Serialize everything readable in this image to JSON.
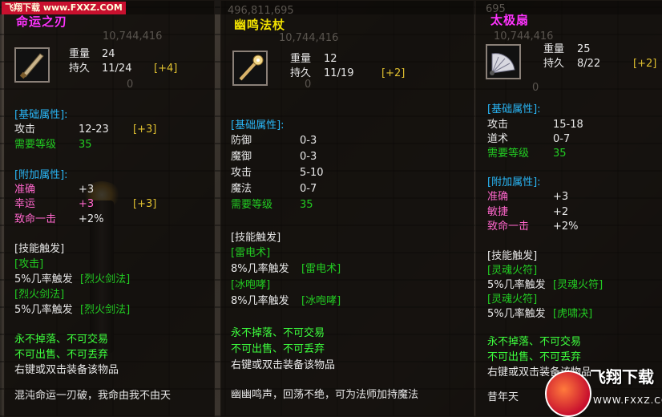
{
  "watermark_top": {
    "name": "飞翔下载",
    "url": "www.FXXZ.COM"
  },
  "watermark_bottom": {
    "name": "飞翔下载",
    "url": "WWW.FXXZ.COM"
  },
  "panels": [
    {
      "bg_numbers": [
        "10,744,416",
        "0"
      ],
      "title": "命运之刃",
      "weight_label": "重量",
      "weight": "24",
      "durability_label": "持久",
      "durability": "11/24",
      "durability_bonus": "[+4]",
      "base_header": "[基础属性]:",
      "base_stats": [
        {
          "label": "攻击",
          "value": "12-23",
          "bonus": "[+3]"
        },
        {
          "label": "需要等级",
          "value": "35",
          "bonus": ""
        }
      ],
      "extra_header": "[附加属性]:",
      "extra_stats": [
        {
          "label": "准确",
          "value": "+3",
          "bonus": ""
        },
        {
          "label": "幸运",
          "value": "+3",
          "bonus": "[+3]"
        },
        {
          "label": "致命一击",
          "value": "+2%",
          "bonus": ""
        }
      ],
      "skill_header": "[技能触发]",
      "skills": [
        {
          "name": "[攻击]",
          "trigger": "5%几率触发",
          "effect": "[烈火剑法]"
        },
        {
          "name": "[烈火剑法]",
          "trigger": "5%几率触发",
          "effect": "[烈火剑法]"
        }
      ],
      "notes": [
        "永不掉落、不可交易",
        "不可出售、不可丢弃",
        "右键或双击装备该物品"
      ],
      "flavor": "混沌命运一刃破，我命由我不由天"
    },
    {
      "bg_numbers": [
        "496,811,695",
        "10,744,416",
        "0"
      ],
      "title": "幽鸣法杖",
      "weight_label": "重量",
      "weight": "12",
      "durability_label": "持久",
      "durability": "11/19",
      "durability_bonus": "[+2]",
      "base_header": "[基础属性]:",
      "base_stats": [
        {
          "label": "防御",
          "value": "0-3",
          "bonus": ""
        },
        {
          "label": "魔御",
          "value": "0-3",
          "bonus": ""
        },
        {
          "label": "攻击",
          "value": "5-10",
          "bonus": ""
        },
        {
          "label": "魔法",
          "value": "0-7",
          "bonus": ""
        },
        {
          "label": "需要等级",
          "value": "35",
          "bonus": ""
        }
      ],
      "skill_header": "[技能触发]",
      "skills": [
        {
          "name": "[雷电术]",
          "trigger": "8%几率触发",
          "effect": "[雷电术]"
        },
        {
          "name": "[冰咆哮]",
          "trigger": "8%几率触发",
          "effect": "[冰咆哮]"
        }
      ],
      "notes": [
        "永不掉落、不可交易",
        "不可出售、不可丢弃",
        "右键或双击装备该物品"
      ],
      "flavor": "幽幽鸣声，回荡不绝，可为法师加持魔法"
    },
    {
      "bg_numbers": [
        "695",
        "10,744,416",
        "0"
      ],
      "title": "太极扇",
      "weight_label": "重量",
      "weight": "25",
      "durability_label": "持久",
      "durability": "8/22",
      "durability_bonus": "[+2]",
      "base_header": "[基础属性]:",
      "base_stats": [
        {
          "label": "攻击",
          "value": "15-18",
          "bonus": ""
        },
        {
          "label": "道术",
          "value": "0-7",
          "bonus": ""
        },
        {
          "label": "需要等级",
          "value": "35",
          "bonus": ""
        }
      ],
      "extra_header": "[附加属性]:",
      "extra_stats": [
        {
          "label": "准确",
          "value": "+3",
          "bonus": ""
        },
        {
          "label": "敏捷",
          "value": "+2",
          "bonus": ""
        },
        {
          "label": "致命一击",
          "value": "+2%",
          "bonus": ""
        }
      ],
      "skill_header": "[技能触发]",
      "skills": [
        {
          "name": "[灵魂火符]",
          "trigger": "5%几率触发",
          "effect": "[灵魂火符]"
        },
        {
          "name": "[灵魂火符]",
          "trigger": "5%几率触发",
          "effect": "[虎啸决]"
        }
      ],
      "notes": [
        "永不掉落、不可交易",
        "不可出售、不可丢弃",
        "右键或双击装备该物品"
      ],
      "flavor": "昔年天"
    }
  ],
  "colors": {
    "title_magenta": "#ff33ff",
    "title_yellow": "#f0e000",
    "header_cyan": "#29b6f6",
    "text_green": "#22cc22",
    "text_white": "#e8e8e8",
    "luck_pink": "#ff66cc",
    "bonus_yellow": "#e0c030"
  },
  "icons": [
    "blade-icon",
    "staff-icon",
    "fan-icon"
  ]
}
